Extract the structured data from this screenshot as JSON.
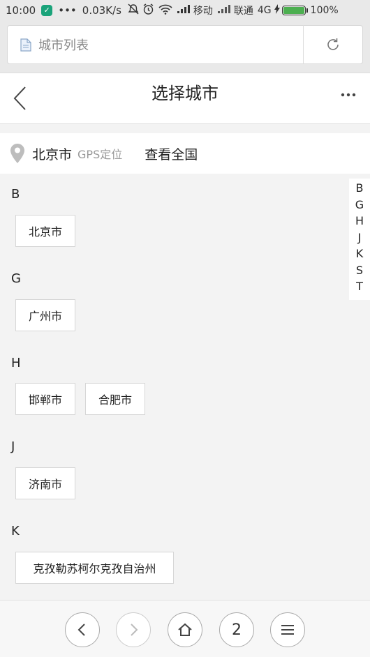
{
  "status_bar": {
    "time": "10:00",
    "dots": "•••",
    "speed": "0.03K/s",
    "carrier1": "移动",
    "carrier2": "联通",
    "network": "4G",
    "battery": "100%",
    "battery_level": 1.0
  },
  "url_bar": {
    "text": "城市列表"
  },
  "header": {
    "title": "选择城市"
  },
  "location": {
    "city": "北京市",
    "gps_label": "GPS定位",
    "view_all": "查看全国"
  },
  "groups": [
    {
      "letter": "B",
      "cities": [
        "北京市"
      ]
    },
    {
      "letter": "G",
      "cities": [
        "广州市"
      ]
    },
    {
      "letter": "H",
      "cities": [
        "邯郸市",
        "合肥市"
      ]
    },
    {
      "letter": "J",
      "cities": [
        "济南市"
      ]
    },
    {
      "letter": "K",
      "cities": [
        "克孜勒苏柯尔克孜自治州"
      ]
    }
  ],
  "index_letters": [
    "B",
    "G",
    "H",
    "J",
    "K",
    "S",
    "T"
  ],
  "bottom_nav": {
    "tab_count": "2"
  },
  "colors": {
    "page_bg": "#f3f3f3",
    "app_badge": "#1aa37a",
    "battery_fill": "#4caf50"
  }
}
